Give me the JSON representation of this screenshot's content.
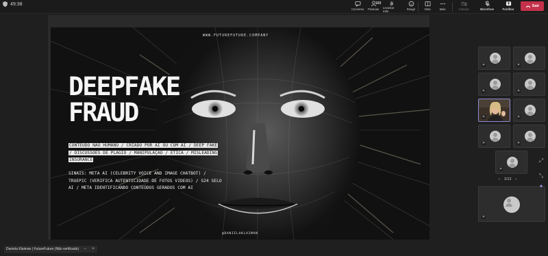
{
  "topbar": {
    "timer": "49:38",
    "buttons": [
      {
        "label": "Conversa",
        "icon": "chat-icon"
      },
      {
        "label": "Pessoas",
        "icon": "people-icon",
        "count": "103"
      },
      {
        "label": "Levantar mão",
        "icon": "raise-hand-icon"
      },
      {
        "label": "Reagir",
        "icon": "react-icon"
      },
      {
        "label": "Vista",
        "icon": "view-icon"
      },
      {
        "label": "Mais",
        "icon": "more-icon"
      },
      {
        "label": "Câmara",
        "icon": "camera-off-icon"
      },
      {
        "label": "Microfone",
        "icon": "mic-off-icon"
      },
      {
        "label": "Partilhar",
        "icon": "share-icon"
      }
    ],
    "leave_label": "Sair",
    "leave_color": "#c4314b"
  },
  "slide": {
    "website": "WWW.FUTUREFUTURE.COMPANY",
    "title_line1": "DEEPFAKE",
    "title_line2": "FRAUD",
    "highlight_text": "CONTEÚDO NÃO HUMANO / CRIADO POR AI OU COM AI / DEEP FAKE / DISCUSSÕES DE PLÁGIO / MANIPULAÇÃO / ÉTICA / MISLEADING INSURANCE",
    "sinais_text": "SINAIS: META AI (CELEBRITY VOICE AND IMAGE CHATBOT) / TRUEPIC (VERIFICA AUTENTICIDADE DE FOTOS VIDEOS) / S24 SELO AI / META IDENTIFICANDO CONTEÚDOS GERADOS COM AI",
    "handle": "@DANIELAKLAIMAN"
  },
  "presenter_label": "Daniela Klaiman | FutureFuture (Não verificado)",
  "morebtn_minus": "−",
  "morebtn_plus": "+",
  "pager": {
    "prev": "‹",
    "text": "1/12",
    "next": "›"
  },
  "accent_color": "#8e8cd8"
}
